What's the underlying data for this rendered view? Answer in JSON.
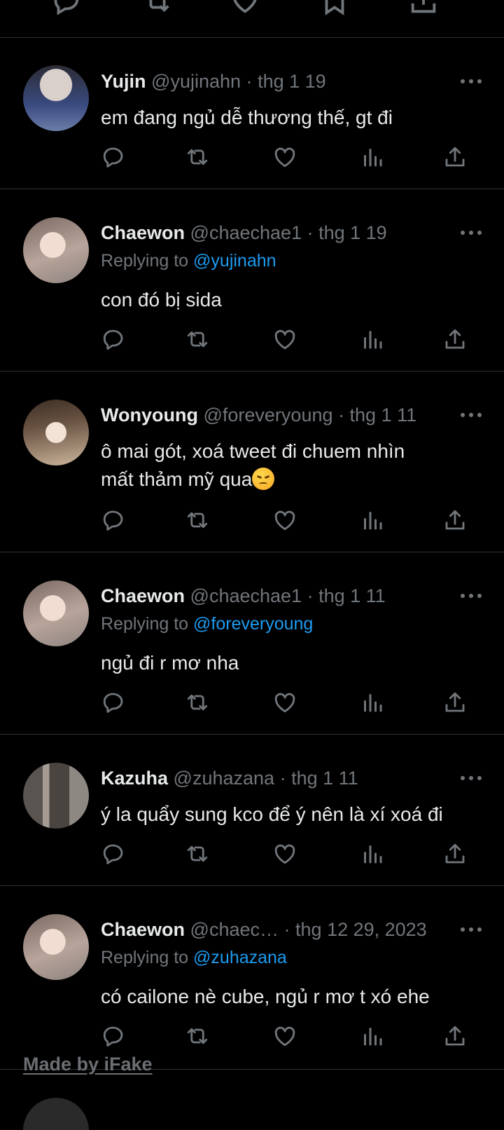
{
  "tweets": [
    {
      "name": "Yujin",
      "handle": "@yujinahn",
      "date": "thg 1 19",
      "replying_prefix": "",
      "replying_to": "",
      "text": "em đang ngủ dễ thương thế, gt đi",
      "avatar_color": "#6a7ea8"
    },
    {
      "name": "Chaewon",
      "handle": "@chaechae1",
      "date": "thg 1 19",
      "replying_prefix": "Replying to",
      "replying_to": "@yujinahn",
      "text": "con đó bị sida",
      "avatar_color": "#b8a49a"
    },
    {
      "name": "Wonyoung",
      "handle": "@foreveryoung",
      "date": "thg 1 11",
      "replying_prefix": "",
      "replying_to": "",
      "text_line1": "ô mai gót, xoá tweet đi chuem nhìn",
      "text_line2": "mất thảm mỹ qua",
      "emoji": "disappointed-face",
      "avatar_color": "#cdb69c"
    },
    {
      "name": "Chaewon",
      "handle": "@chaechae1",
      "date": "thg 1 11",
      "replying_prefix": "Replying to",
      "replying_to": "@foreveryoung",
      "text": "ngủ đi r mơ nha",
      "avatar_color": "#b8a49a"
    },
    {
      "name": "Kazuha",
      "handle": "@zuhazana",
      "date": "thg 1 11",
      "replying_prefix": "",
      "replying_to": "",
      "text": "ý la quẩy sung kco để ý nên là xí xoá đi",
      "avatar_color": "#7a7470"
    },
    {
      "name": "Chaewon",
      "handle": "@chaec…",
      "date": "thg 12 29, 2023",
      "replying_prefix": "Replying to",
      "replying_to": "@zuhazana",
      "text": "có cailone nè cube, ngủ r mơ t xó ehe",
      "avatar_color": "#b8a49a"
    }
  ],
  "separator": "·",
  "watermark": "Made by iFake",
  "colors": {
    "background": "#000000",
    "text": "#e7e9ea",
    "muted": "#71767b",
    "link": "#1d9bf0",
    "divider": "#2f3336"
  },
  "icons": [
    "reply-icon",
    "retweet-icon",
    "like-icon",
    "views-icon",
    "share-icon",
    "bookmark-icon",
    "more-icon"
  ]
}
